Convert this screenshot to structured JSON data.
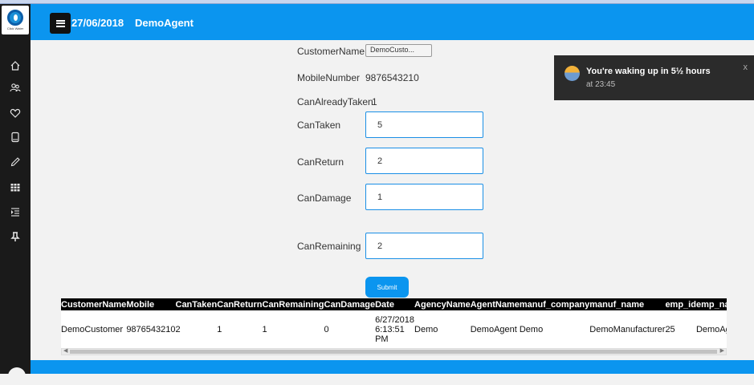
{
  "header": {
    "date": "27/06/2018",
    "agent": "DemoAgent"
  },
  "sidebar": {
    "logo_text": "Click Water",
    "icons": [
      "home-icon",
      "users-icon",
      "heart-icon",
      "tablet-icon",
      "pencil-icon",
      "grid-icon",
      "indent-icon",
      "pin-icon"
    ]
  },
  "form": {
    "customer_label": "CustomerName",
    "customer_value": "DemoCusto...",
    "mobile_label": "MobileNumber",
    "mobile_value": "9876543210",
    "already_label": "CanAlreadyTaken",
    "already_value": "1",
    "taken_label": "CanTaken",
    "taken_value": "5",
    "return_label": "CanReturn",
    "return_value": "2",
    "damage_label": "CanDamage",
    "damage_value": "1",
    "remaining_label": "CanRemaining",
    "remaining_value": "2",
    "submit_label": "Submit"
  },
  "notification": {
    "title": "You're waking up in 5½ hours",
    "time": "at 23:45",
    "close": "x"
  },
  "table": {
    "headers": [
      "CustomerName",
      "Mobile",
      "CanTaken",
      "CanReturn",
      "CanRemaining",
      "CanDamage",
      "Date",
      "AgencyName",
      "AgentName",
      "manuf_company",
      "manuf_name",
      "emp_id",
      "emp_name"
    ],
    "rows": [
      [
        "DemoCustomer",
        "9876543210",
        "2",
        "1",
        "1",
        "0",
        "6/27/2018 6:13:51 PM",
        "Demo",
        "DemoAgent",
        "Demo",
        "DemoManufacturer",
        "25",
        "DemoAgent"
      ]
    ]
  },
  "colors": {
    "header_bg": "#0b95ef",
    "sidebar_bg": "#1a1a1a",
    "input_border": "#1a8fe6"
  }
}
